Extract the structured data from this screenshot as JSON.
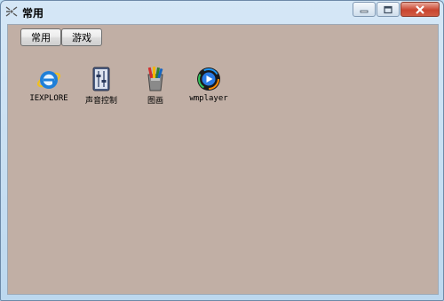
{
  "window": {
    "title": "常用"
  },
  "tabs": [
    {
      "label": "常用"
    },
    {
      "label": "游戏"
    }
  ],
  "apps": [
    {
      "label": "IEXPLORE",
      "icon": "internet-explorer-icon"
    },
    {
      "label": "声音控制",
      "icon": "volume-control-icon"
    },
    {
      "label": "图画",
      "icon": "paint-icon"
    },
    {
      "label": "wmplayer",
      "icon": "media-player-icon"
    }
  ],
  "colors": {
    "client_bg": "#c1afa5",
    "frame": "#bcd8ef"
  }
}
